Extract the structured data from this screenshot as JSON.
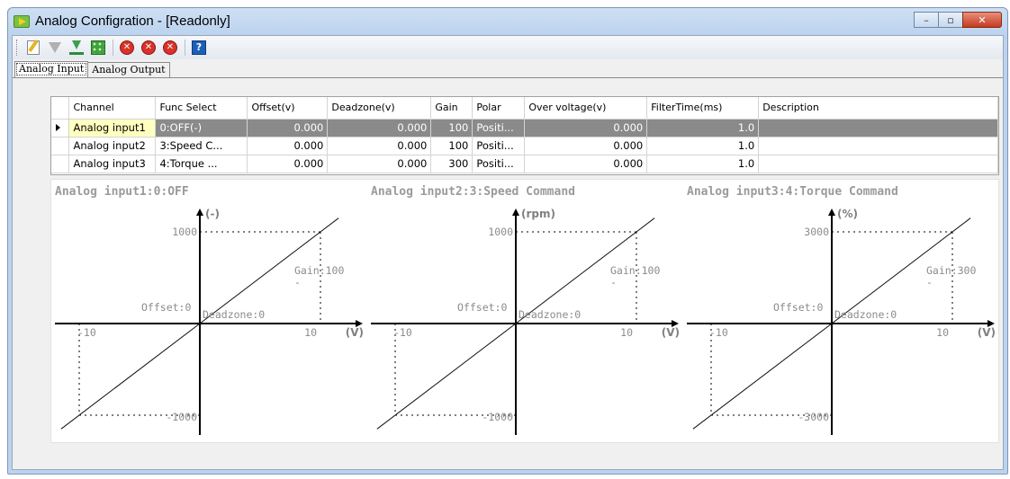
{
  "window": {
    "title": "Analog Configration - [Readonly]",
    "controls": {
      "minimize": "–",
      "maximize": "▫",
      "close": "✕"
    }
  },
  "toolbar": {
    "items": [
      "edit-icon",
      "download-arrow-icon",
      "download-to-drive-icon",
      "grid-icon",
      "stop-icon",
      "stop-icon",
      "stop-icon",
      "help-icon"
    ]
  },
  "tabs": [
    "Analog Input",
    "Analog Output"
  ],
  "table": {
    "columns": [
      "Channel",
      "Func Select",
      "Offset(v)",
      "Deadzone(v)",
      "Gain",
      "Polar",
      "Over voltage(v)",
      "FilterTime(ms)",
      "Description"
    ],
    "rows": [
      [
        "Analog input1",
        "0:OFF(-)",
        "0.000",
        "0.000",
        "100",
        "Positi...",
        "0.000",
        "1.0",
        ""
      ],
      [
        "Analog input2",
        "3:Speed C...",
        "0.000",
        "0.000",
        "100",
        "Positi...",
        "0.000",
        "1.0",
        ""
      ],
      [
        "Analog input3",
        "4:Torque ...",
        "0.000",
        "0.000",
        "300",
        "Positi...",
        "0.000",
        "1.0",
        ""
      ]
    ],
    "selected_row": 0
  },
  "charts": [
    {
      "title": "Analog input1:0:OFF",
      "unit": "(-)",
      "ymax_label": "1000",
      "ymin_label": "-1000",
      "xmin_label": "-10",
      "xmax_label": "10",
      "x_unit": "(V)",
      "gain_label": "Gain:100",
      "gain_sub": "-",
      "offset_label": "Offset:0",
      "deadzone_label": "Deadzone:0"
    },
    {
      "title": "Analog input2:3:Speed Command",
      "unit": "(rpm)",
      "ymax_label": "1000",
      "ymin_label": "-1000",
      "xmin_label": "-10",
      "xmax_label": "10",
      "x_unit": "(V)",
      "gain_label": "Gain:100",
      "gain_sub": "-",
      "offset_label": "Offset:0",
      "deadzone_label": "Deadzone:0"
    },
    {
      "title": "Analog input3:4:Torque Command",
      "unit": "(%)",
      "ymax_label": "3000",
      "ymin_label": "-3000",
      "xmin_label": "-10",
      "xmax_label": "10",
      "x_unit": "(V)",
      "gain_label": "Gain:300",
      "gain_sub": "-",
      "offset_label": "Offset:0",
      "deadzone_label": "Deadzone:0"
    }
  ],
  "chart_data": [
    {
      "type": "line",
      "title": "Analog input1:0:OFF",
      "xlabel": "(V)",
      "ylabel": "(-)",
      "xlim": [
        -10,
        10
      ],
      "ylim": [
        -1000,
        1000
      ],
      "series": [
        {
          "x": [
            -10,
            10
          ],
          "y": [
            -1000,
            1000
          ]
        }
      ]
    },
    {
      "type": "line",
      "title": "Analog input2:3:Speed Command",
      "xlabel": "(V)",
      "ylabel": "(rpm)",
      "xlim": [
        -10,
        10
      ],
      "ylim": [
        -1000,
        1000
      ],
      "series": [
        {
          "x": [
            -10,
            10
          ],
          "y": [
            -1000,
            1000
          ]
        }
      ]
    },
    {
      "type": "line",
      "title": "Analog input3:4:Torque Command",
      "xlabel": "(V)",
      "ylabel": "(%)",
      "xlim": [
        -10,
        10
      ],
      "ylim": [
        -3000,
        3000
      ],
      "series": [
        {
          "x": [
            -10,
            10
          ],
          "y": [
            -3000,
            3000
          ]
        }
      ]
    }
  ]
}
